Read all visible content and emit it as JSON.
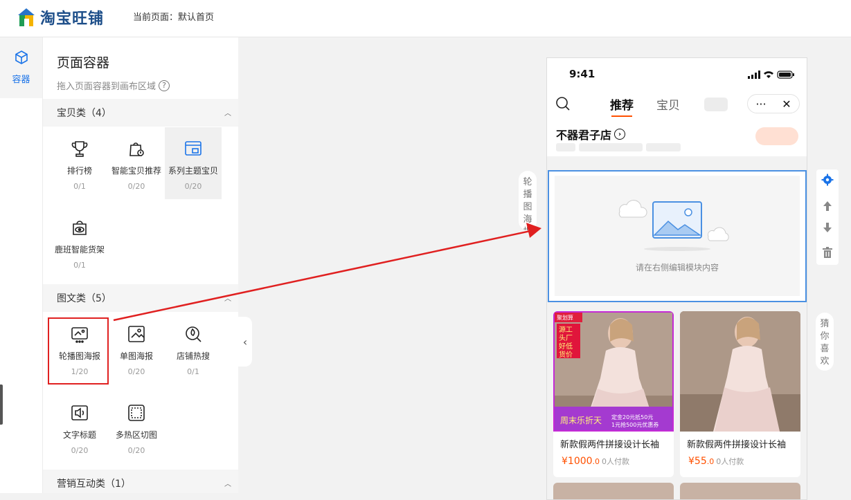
{
  "header": {
    "brand": "淘宝旺铺",
    "current_page": "当前页面：默认首页"
  },
  "rail": {
    "item_label": "容器",
    "icon": "cube-icon"
  },
  "panel": {
    "title": "页面容器",
    "subtitle": "拖入页面容器到画布区域",
    "help": "?",
    "groups": [
      {
        "label": "宝贝类（4）",
        "items": [
          {
            "name": "排行榜",
            "count": "0/1",
            "icon": "trophy-icon"
          },
          {
            "name": "智能宝贝推荐",
            "count": "0/20",
            "icon": "smart-bag-icon"
          },
          {
            "name": "系列主题宝贝",
            "count": "0/20",
            "icon": "theme-window-icon"
          },
          {
            "name": "鹿班智能货架",
            "count": "0/1",
            "icon": "shelf-eye-icon"
          }
        ]
      },
      {
        "label": "图文类（5）",
        "items": [
          {
            "name": "轮播图海报",
            "count": "1/20",
            "icon": "carousel-icon"
          },
          {
            "name": "单图海报",
            "count": "0/20",
            "icon": "single-poster-icon"
          },
          {
            "name": "店铺热搜",
            "count": "0/1",
            "icon": "hot-search-icon"
          },
          {
            "name": "文字标题",
            "count": "0/20",
            "icon": "text-title-icon"
          },
          {
            "name": "多热区切图",
            "count": "0/20",
            "icon": "hotspot-icon"
          }
        ]
      },
      {
        "label": "营销互动类（1）",
        "items": []
      }
    ]
  },
  "phone": {
    "time": "9:41",
    "tabs": [
      "推荐",
      "宝贝"
    ],
    "shop_name": "不器君子店",
    "carousel_hint": "请在右侧编辑模块内容",
    "products": [
      {
        "title": "新款假两件拼接设计长袖",
        "price": "¥1000",
        "decimal": ".0",
        "paid": "0人付款",
        "promo": {
          "tag": "聚划算",
          "banner": "源头工厂好货低价",
          "sale": "周末乐折天",
          "coupon1": "定金20元抵50元",
          "coupon2": "1元抢500元优惠券"
        }
      },
      {
        "title": "新款假两件拼接设计长袖",
        "price": "¥55",
        "decimal": ".0",
        "paid": "0人付款"
      }
    ]
  },
  "side_labels": {
    "carousel": "轮播图海报",
    "guess": "猜你喜欢"
  },
  "colors": {
    "accent": "#1a73e8",
    "brand_orange": "#ff5000",
    "highlight_red": "#e02020",
    "selection_blue": "#4a90e2"
  }
}
